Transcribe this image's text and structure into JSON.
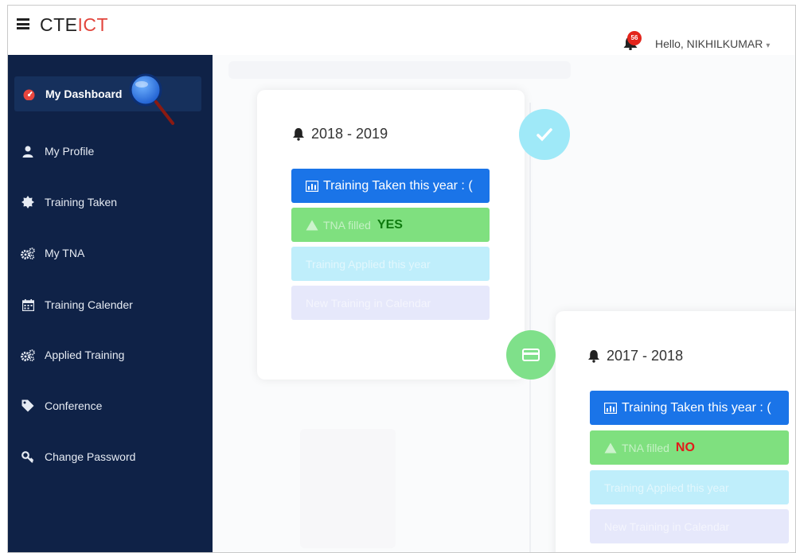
{
  "header": {
    "brand_part1": "CTE",
    "brand_part2": "ICT",
    "notification_count": "56",
    "greeting": "Hello, NIKHILKUMAR"
  },
  "sidebar": {
    "items": [
      {
        "label": "My Dashboard",
        "icon": "dashboard-icon"
      },
      {
        "label": "My Profile",
        "icon": "user-icon"
      },
      {
        "label": "Training Taken",
        "icon": "certificate-icon"
      },
      {
        "label": "My TNA",
        "icon": "gears-icon"
      },
      {
        "label": "Training Calender",
        "icon": "calendar-icon"
      },
      {
        "label": "Applied Training",
        "icon": "gears-icon"
      },
      {
        "label": "Conference",
        "icon": "tag-icon"
      },
      {
        "label": "Change Password",
        "icon": "key-icon"
      }
    ]
  },
  "timeline": [
    {
      "year": "2018 - 2019",
      "training_taken_label": "Training Taken this year : (",
      "tna_label": "TNA filled",
      "tna_value": "YES",
      "applied_label": "Training Applied this year",
      "calendar_label": "New Training in Calendar"
    },
    {
      "year": "2017 - 2018",
      "training_taken_label": "Training Taken this year : (",
      "tna_label": "TNA filled",
      "tna_value": "NO",
      "applied_label": "Training Applied this year",
      "calendar_label": "New Training in Calendar"
    }
  ],
  "colors": {
    "sidebar_bg": "#0f2247",
    "brand_accent": "#e2453c",
    "pill_blue": "#1a74e8",
    "pill_green": "#7fe07f",
    "yes_color": "#0e7a0e",
    "no_color": "#e11b1b"
  }
}
